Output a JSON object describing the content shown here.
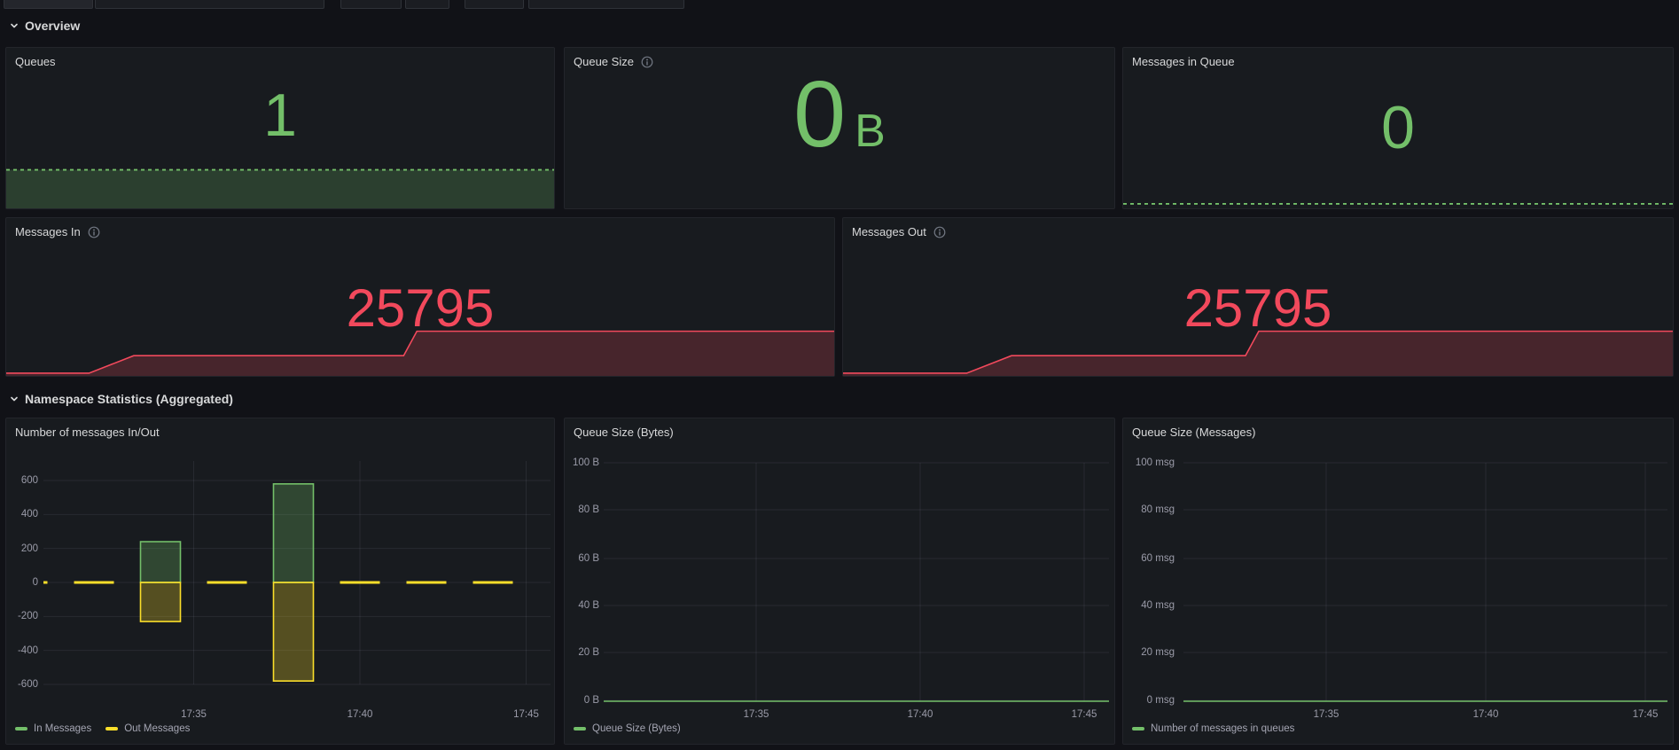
{
  "sections": {
    "overview": "Overview",
    "namespace": "Namespace Statistics (Aggregated)"
  },
  "panels": {
    "queues": {
      "title": "Queues",
      "value": "1",
      "color": "#73bf69",
      "sparkline": {
        "points_pct": [
          [
            0,
            0.76
          ],
          [
            1,
            0.76
          ]
        ],
        "fill": true,
        "dash": true,
        "color": "#73bf69",
        "fill_color": "rgba(115,191,105,0.22)"
      }
    },
    "queue_size": {
      "title": "Queue Size",
      "value": "0",
      "unit": "B",
      "color": "#73bf69"
    },
    "messages_in_queue": {
      "title": "Messages in Queue",
      "value": "0",
      "color": "#73bf69",
      "sparkline": {
        "points_pct": [
          [
            0,
            0.972
          ],
          [
            1,
            0.972
          ]
        ],
        "fill": false,
        "dash": true,
        "color": "#73bf69"
      }
    },
    "messages_in": {
      "title": "Messages In",
      "value": "25795",
      "color": "#f2495c",
      "sparkline": {
        "points_pct": [
          [
            0,
            0.983
          ],
          [
            0.1,
            0.983
          ],
          [
            0.154,
            0.872
          ],
          [
            0.48,
            0.872
          ],
          [
            0.496,
            0.717
          ],
          [
            1,
            0.717
          ]
        ],
        "fill": true,
        "dash": false,
        "color": "#f2495c",
        "fill_color": "rgba(242,73,92,0.22)"
      }
    },
    "messages_out": {
      "title": "Messages Out",
      "value": "25795",
      "color": "#f2495c",
      "sparkline": {
        "points_pct": [
          [
            0,
            0.983
          ],
          [
            0.149,
            0.983
          ],
          [
            0.203,
            0.872
          ],
          [
            0.485,
            0.872
          ],
          [
            0.501,
            0.717
          ],
          [
            1,
            0.717
          ]
        ],
        "fill": true,
        "dash": false,
        "color": "#f2495c",
        "fill_color": "rgba(242,73,92,0.22)"
      }
    }
  },
  "chart_data": [
    {
      "id": "in_out_bars",
      "type": "bar",
      "title": "Number of messages In/Out",
      "x": [
        "17:30",
        "17:32",
        "17:34",
        "17:36",
        "17:38",
        "17:40",
        "17:42",
        "17:44"
      ],
      "series": [
        {
          "name": "In Messages",
          "color": "#73bf69",
          "values": [
            0,
            0,
            240,
            0,
            580,
            0,
            0,
            0
          ]
        },
        {
          "name": "Out Messages",
          "color": "#fade2a",
          "values": [
            0,
            0,
            -230,
            0,
            -580,
            0,
            0,
            0
          ]
        }
      ],
      "ylim": [
        -700,
        700
      ],
      "ytick_values": [
        600,
        400,
        200,
        0,
        -200,
        -400,
        -600
      ],
      "xtick_labels": [
        "17:35",
        "17:40",
        "17:45"
      ],
      "grid": true,
      "legend_position": "bottom-left"
    },
    {
      "id": "queue_bytes",
      "type": "line",
      "title": "Queue Size (Bytes)",
      "series": [
        {
          "name": "Queue Size (Bytes)",
          "color": "#73bf69",
          "constant_value": 0
        }
      ],
      "ylim": [
        0,
        100
      ],
      "ytick_labels": [
        "100 B",
        "80 B",
        "60 B",
        "40 B",
        "20 B",
        "0 B"
      ],
      "xtick_labels": [
        "17:35",
        "17:40",
        "17:45"
      ],
      "grid": true,
      "legend_position": "bottom-left"
    },
    {
      "id": "queue_msgs",
      "type": "line",
      "title": "Queue Size (Messages)",
      "series": [
        {
          "name": "Number of messages in queues",
          "color": "#73bf69",
          "constant_value": 0
        }
      ],
      "ylim": [
        0,
        100
      ],
      "ytick_labels": [
        "100 msg",
        "80 msg",
        "60 msg",
        "40 msg",
        "20 msg",
        "0 msg"
      ],
      "xtick_labels": [
        "17:35",
        "17:40",
        "17:45"
      ],
      "grid": true,
      "legend_position": "bottom-left"
    }
  ],
  "colors": {
    "page_bg": "#111217",
    "panel_bg": "#181b1f",
    "green": "#73bf69",
    "yellow": "#fade2a",
    "red": "#f2495c",
    "grid": "rgba(204,204,220,0.09)"
  }
}
